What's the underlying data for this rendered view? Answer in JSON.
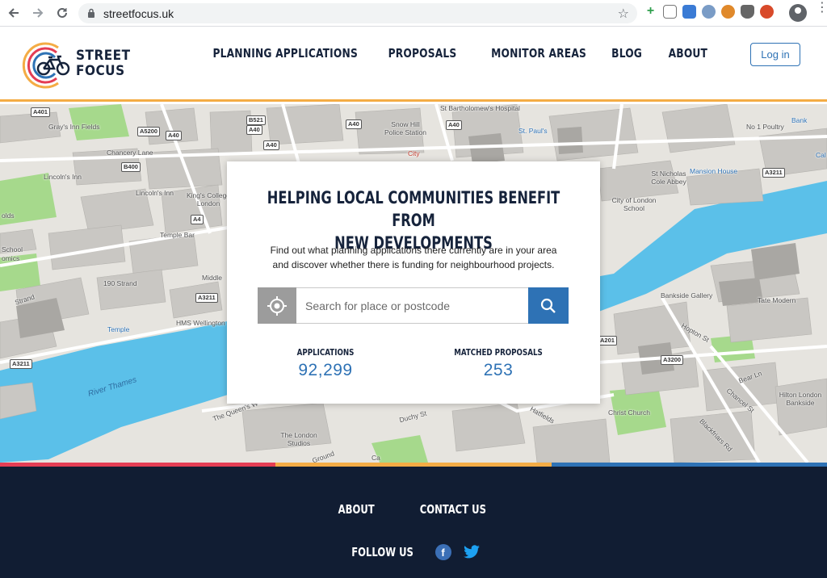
{
  "browser": {
    "url": "streetfocus.uk",
    "back_icon": "arrow-left-icon",
    "forward_icon": "arrow-right-icon",
    "reload_icon": "reload-icon",
    "star_icon": "star-icon"
  },
  "brand": {
    "line1": "STREET",
    "line2": "FOCUS",
    "colors": {
      "navy": "#16233b",
      "blue": "#2e72b5",
      "orange": "#f4ac45",
      "red": "#e43d54"
    }
  },
  "nav": {
    "items": [
      "PLANNING APPLICATIONS",
      "PROPOSALS",
      "MONITOR AREAS",
      "BLOG",
      "ABOUT"
    ],
    "login_label": "Log in"
  },
  "hero": {
    "title_line1": "HELPING LOCAL COMMUNITIES BENEFIT FROM",
    "title_line2": "NEW DEVELOPMENTS",
    "desc_line1": "Find out what planning applications there currently are in your area",
    "desc_line2": "and discover whether there is funding for neighbourhood projects.",
    "search_placeholder": "Search for place or postcode",
    "stats": [
      {
        "label": "APPLICATIONS",
        "value": "92,299"
      },
      {
        "label": "MATCHED PROPOSALS",
        "value": "253"
      }
    ]
  },
  "map": {
    "labels": [
      "Gray's Inn Fields",
      "Chancery Lane",
      "Lincoln's Inn",
      "Lincoln's Inn",
      "King's College London",
      "Temple Bar",
      "190 Strand",
      "Middle",
      "Temple",
      "HMS Wellington",
      "School",
      "omics",
      "olds",
      "Strand",
      "Snow Hill Police Station",
      "St Bartholomew's Hospital",
      "City",
      "St. Paul's",
      "No 1 Poultry",
      "Bank",
      "St Nicholas Cole Abbey",
      "Mansion House",
      "City of London School",
      "Bankside Gallery",
      "Tate Modern",
      "Christ Church",
      "Hilton London Bankside",
      "The London Studios",
      "Duchy St",
      "Hatfields",
      "Hopton St",
      "Bear Ln",
      "Chancel St",
      "Blackfriars Rd",
      "The Queen's W",
      "Ground",
      "Ca",
      "Cal"
    ],
    "water_label": "River Thames",
    "roads": [
      "A401",
      "A5200",
      "A40",
      "B521",
      "A40",
      "A40",
      "A40",
      "B400",
      "A4",
      "A3211",
      "A3211",
      "A3211",
      "A3200",
      "A201",
      "A40"
    ]
  },
  "footer": {
    "links": [
      "ABOUT",
      "CONTACT US"
    ],
    "follow_label": "FOLLOW US",
    "facebook_glyph": "f"
  }
}
